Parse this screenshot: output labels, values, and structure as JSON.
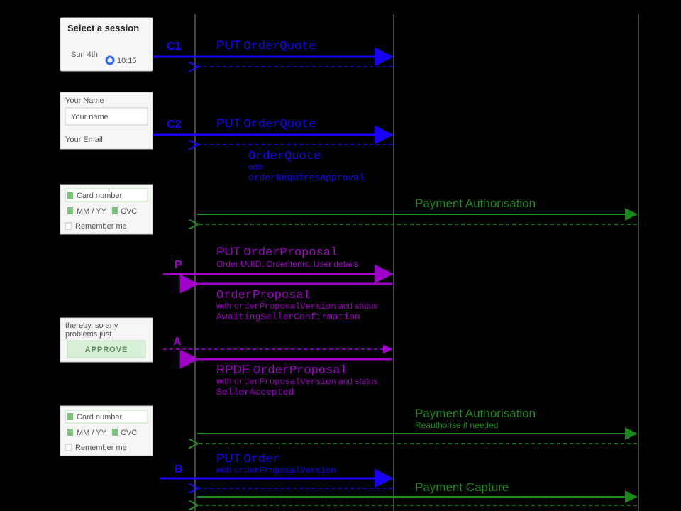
{
  "lanes": {
    "ui": 150,
    "mid": 275,
    "booking": 555,
    "payment": 900
  },
  "mockups": {
    "session": {
      "title": "Select a session",
      "day": "Sun 4th",
      "time": "10:15"
    },
    "form": {
      "nameLabel": "Your Name",
      "namePh": "Your name",
      "emailLabel": "Your Email"
    },
    "card": {
      "numPh": "Card number",
      "expPh": "MM / YY",
      "cvcPh": "CVC",
      "remember": "Remember me"
    },
    "approve": {
      "button": "APPROVE"
    }
  },
  "steps": {
    "c1": {
      "label": "C1",
      "title_verb": "PUT ",
      "title_code": "OrderQuote"
    },
    "c2": {
      "label": "C2",
      "title_verb": "PUT ",
      "title_code": "OrderQuote",
      "resp_code": "OrderQuote",
      "resp_with": "with",
      "resp_mono": "orderRequiresApproval"
    },
    "pay1": {
      "title": "Payment Authorisation"
    },
    "p": {
      "label": "P",
      "title_verb": "PUT ",
      "title_code": "OrderProposal",
      "sub": "Order UUID, OrderItems, User details",
      "resp_code": "OrderProposal",
      "resp_l1a": "with ",
      "resp_l1b": "orderProposalVersion",
      "resp_l1c": " and status",
      "resp_l2": "AwaitingSellerConfirmation"
    },
    "a": {
      "label": "A",
      "resp_pre": "RPDE ",
      "resp_code": "OrderProposal",
      "resp_l1a": "with ",
      "resp_l1b": "orderProposalVersion",
      "resp_l1c": " and status",
      "resp_l2": "SellerAccepted"
    },
    "pay2": {
      "title": "Payment Authorisation",
      "sub": "Reauthorise if needed"
    },
    "b": {
      "label": "B",
      "title_verb": "PUT ",
      "title_code": "Order",
      "sub_a": "with ",
      "sub_b": "orderProposalVersion"
    },
    "pay3": {
      "title": "Payment Capture"
    }
  }
}
